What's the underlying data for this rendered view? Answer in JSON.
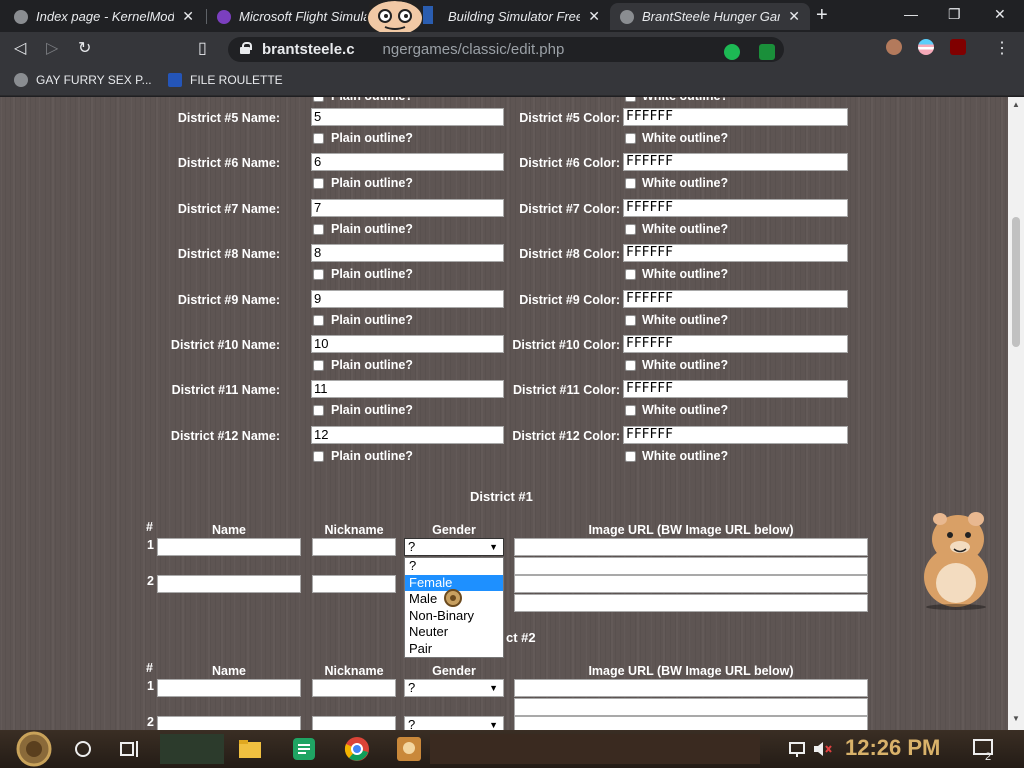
{
  "tabs": [
    {
      "title": "Index page - KernelMode",
      "close": "✕"
    },
    {
      "title": "Microsoft Flight Simulator",
      "close": "✕"
    },
    {
      "title": "Building Simulator Free",
      "close": "✕"
    },
    {
      "title": "BrantSteele Hunger Games",
      "close": "✕"
    }
  ],
  "new_tab": "+",
  "address": {
    "domain": "brantsteele.c",
    "path": "ngergames/classic/edit.php"
  },
  "bookmarks": [
    {
      "label": "GAY FURRY SEX P..."
    },
    {
      "label": "FILE ROULETTE"
    }
  ],
  "districts": [
    {
      "name_label": "District #5 Name:",
      "name_value": "5",
      "color_label": "District #5 Color:",
      "color_value": "FFFFFF"
    },
    {
      "name_label": "District #6 Name:",
      "name_value": "6",
      "color_label": "District #6 Color:",
      "color_value": "FFFFFF"
    },
    {
      "name_label": "District #7 Name:",
      "name_value": "7",
      "color_label": "District #7 Color:",
      "color_value": "FFFFFF"
    },
    {
      "name_label": "District #8 Name:",
      "name_value": "8",
      "color_label": "District #8 Color:",
      "color_value": "FFFFFF"
    },
    {
      "name_label": "District #9 Name:",
      "name_value": "9",
      "color_label": "District #9 Color:",
      "color_value": "FFFFFF"
    },
    {
      "name_label": "District #10 Name:",
      "name_value": "10",
      "color_label": "District #10 Color:",
      "color_value": "FFFFFF"
    },
    {
      "name_label": "District #11 Name:",
      "name_value": "11",
      "color_label": "District #11 Color:",
      "color_value": "FFFFFF"
    },
    {
      "name_label": "District #12 Name:",
      "name_value": "12",
      "color_label": "District #12 Color:",
      "color_value": "FFFFFF"
    }
  ],
  "plain_outline_label": "Plain outline?",
  "white_outline_label": "White outline?",
  "tribute_sections": [
    {
      "heading": "District #1",
      "hash": "#",
      "col_name": "Name",
      "col_nickname": "Nickname",
      "col_gender": "Gender",
      "col_image": "Image URL (BW Image URL below)",
      "row1": "1",
      "row2": "2",
      "gender1": "?",
      "gender2": "?"
    },
    {
      "heading": "ct #2",
      "hash": "#",
      "col_name": "Name",
      "col_nickname": "Nickname",
      "col_gender": "Gender",
      "col_image": "Image URL (BW Image URL below)",
      "row1": "1",
      "row2": "2",
      "gender1": "?",
      "gender2": "?"
    }
  ],
  "gender_options": [
    "?",
    "Female",
    "Male",
    "Non-Binary",
    "Neuter",
    "Pair"
  ],
  "gender_highlighted": "Female",
  "clock": "12:26 PM",
  "notifications": "2",
  "colors": {
    "page_bg": "#5e5553",
    "highlight": "#1e90ff",
    "clock": "#d9b26a"
  }
}
